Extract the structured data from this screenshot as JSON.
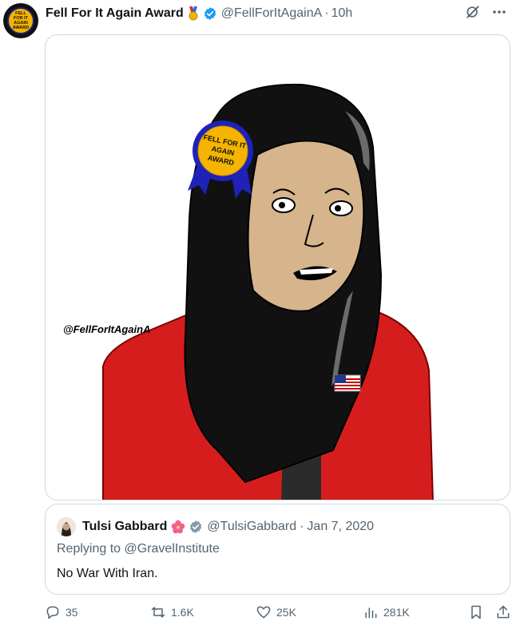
{
  "post": {
    "author_name": "Fell For It Again Award",
    "medal_emoji": "🎖️",
    "handle": "@FellForItAgainA",
    "separator": "·",
    "time": "10h",
    "avatar_text": "FELL FOR IT AGAIN AWARD"
  },
  "media": {
    "ribbon_lines": [
      "FELL FOR IT",
      "AGAIN",
      "AWARD"
    ],
    "watermark": "@FellForItAgainA"
  },
  "quote": {
    "name": "Tulsi Gabbard",
    "flower_emoji": "🌺",
    "handle": "@TulsiGabbard",
    "separator": "·",
    "date": "Jan 7, 2020",
    "replying_prefix": "Replying to",
    "replying_mention": "@GravelInstitute",
    "text": "No War With Iran."
  },
  "actions": {
    "replies": "35",
    "reposts": "1.6K",
    "likes": "25K",
    "views": "281K"
  },
  "colors": {
    "verified": "#1d9bf0",
    "secondary_text": "#536471",
    "border": "#cfd9de",
    "jacket_red": "#d61d1d",
    "ribbon_gold": "#f4b400",
    "ribbon_blue": "#1e22b8"
  }
}
